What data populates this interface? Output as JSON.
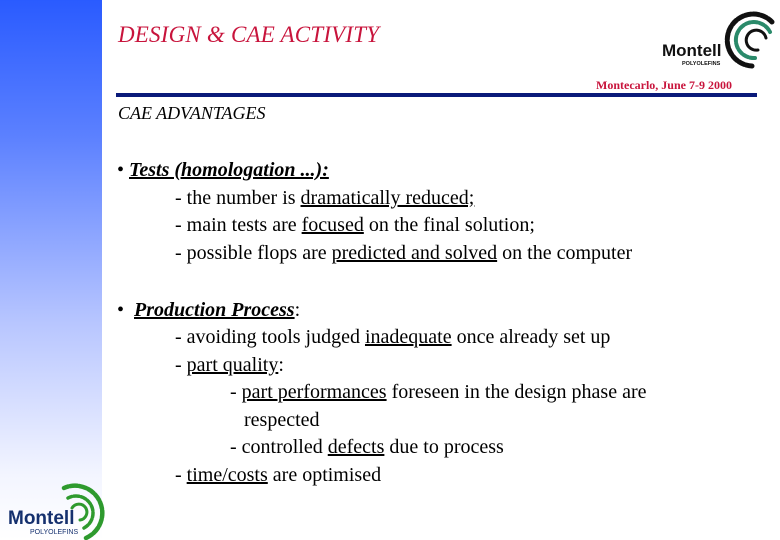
{
  "header": {
    "title": "DESIGN & CAE ACTIVITY",
    "date_line": "Montecarlo, June 7-9 2000",
    "subtitle": "CAE ADVANTAGES",
    "logo": {
      "name": "Montell",
      "tagline": "POLYOLEFINS"
    }
  },
  "colors": {
    "title_red": "#c8143c",
    "rule_navy": "#0a1a7a",
    "sidebar_blue": "#2a5bff",
    "logo_green": "#2e9a2e"
  },
  "sections": [
    {
      "bullet": "•",
      "heading": "Tests (homologation ...):",
      "heading_suffix": "",
      "items": [
        {
          "prefix": "- the number is ",
          "emph": "dramatically reduced;",
          "suffix": ""
        },
        {
          "prefix": "- main tests are ",
          "emph": "focused",
          "suffix": " on the final solution;"
        },
        {
          "prefix": "- possible flops are ",
          "emph": "predicted and solved",
          "suffix": " on the computer"
        }
      ]
    },
    {
      "bullet": "•",
      "heading": "Production Process",
      "heading_suffix": ":",
      "items": [
        {
          "prefix": "- avoiding tools judged ",
          "emph": "inadequate",
          "suffix": " once already set up"
        },
        {
          "prefix": "- ",
          "emph": "part quality",
          "suffix": ":"
        },
        {
          "prefix": "- ",
          "emph": "part performances",
          "suffix": " foreseen in the design phase are",
          "continuation": "respected"
        },
        {
          "prefix": "- controlled ",
          "emph": "defects",
          "suffix": " due to process"
        },
        {
          "prefix": "- ",
          "emph": "time/costs",
          "suffix": " are optimised"
        }
      ]
    }
  ],
  "footer": {
    "logo": {
      "name": "Montell",
      "tagline": "POLYOLEFINS"
    }
  }
}
